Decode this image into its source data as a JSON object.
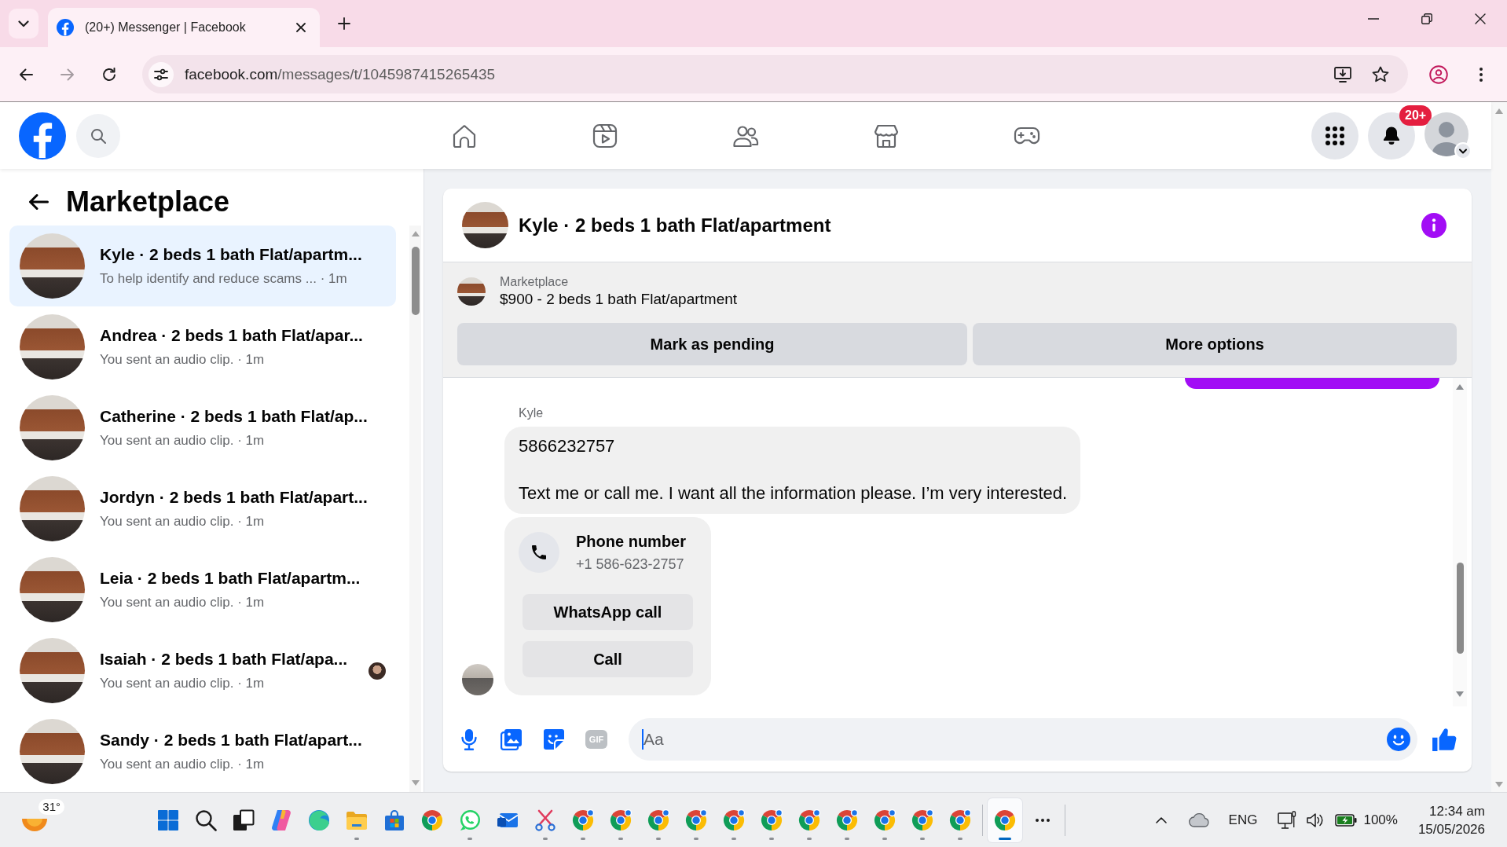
{
  "browser": {
    "tab_title": "(20+) Messenger | Facebook",
    "url_host": "facebook.com",
    "url_path": "/messages/t/1045987415265435",
    "forward_disabled": true
  },
  "header": {
    "nav": [
      {
        "kind": "home"
      },
      {
        "kind": "video"
      },
      {
        "kind": "friends"
      },
      {
        "kind": "marketplace"
      },
      {
        "kind": "gaming"
      }
    ],
    "notification_badge": "20+"
  },
  "sidebar": {
    "title": "Marketplace",
    "conversations": [
      {
        "title": "Kyle · 2 beds 1 bath Flat/apartm...",
        "snippet": "To help identify and reduce scams ... · 1m",
        "selected": true,
        "seen_by": false
      },
      {
        "title": "Andrea · 2 beds 1 bath Flat/apar...",
        "snippet": "You sent an audio clip. · 1m",
        "selected": false,
        "seen_by": false
      },
      {
        "title": "Catherine · 2 beds 1 bath Flat/ap...",
        "snippet": "You sent an audio clip. · 1m",
        "selected": false,
        "seen_by": false
      },
      {
        "title": "Jordyn · 2 beds 1 bath Flat/apart...",
        "snippet": "You sent an audio clip. · 1m",
        "selected": false,
        "seen_by": false
      },
      {
        "title": "Leia · 2 beds 1 bath Flat/apartm...",
        "snippet": "You sent an audio clip. · 1m",
        "selected": false,
        "seen_by": false
      },
      {
        "title": "Isaiah · 2 beds 1 bath Flat/apa...",
        "snippet": "You sent an audio clip. · 1m",
        "selected": false,
        "seen_by": true
      },
      {
        "title": "Sandy · 2 beds 1 bath Flat/apart...",
        "snippet": "You sent an audio clip. · 1m",
        "selected": false,
        "seen_by": false
      }
    ]
  },
  "chat": {
    "title": "Kyle · 2 beds 1 bath Flat/apartment",
    "listing": {
      "label": "Marketplace",
      "description": "$900 - 2 beds 1 bath Flat/apartment",
      "actions": [
        "Mark as pending",
        "More options"
      ]
    },
    "messages": [
      {
        "kind": "sent_cut"
      },
      {
        "kind": "received",
        "sender": "Kyle",
        "items": [
          {
            "kind": "text",
            "paragraphs": [
              "5866232757",
              "Text me or call me. I want all the information please. I’m very interested."
            ]
          },
          {
            "kind": "contact",
            "title": "Phone number",
            "phone": "+1 586-623-2757",
            "actions": [
              "WhatsApp call",
              "Call"
            ]
          }
        ]
      }
    ],
    "composer": {
      "placeholder": "Aa",
      "gif_label": "GIF"
    }
  },
  "taskbar": {
    "temperature": "31°",
    "apps": [
      {
        "kind": "start",
        "running": false,
        "selected": false
      },
      {
        "kind": "search",
        "running": false,
        "selected": false
      },
      {
        "kind": "task_view",
        "running": false,
        "selected": false
      },
      {
        "kind": "copilot",
        "running": false,
        "selected": false
      },
      {
        "kind": "edge",
        "running": false,
        "selected": false
      },
      {
        "kind": "files",
        "running": true,
        "selected": false
      },
      {
        "kind": "store",
        "running": false,
        "selected": false
      },
      {
        "kind": "browser",
        "running": false,
        "selected": false
      },
      {
        "kind": "chat",
        "running": true,
        "selected": false
      },
      {
        "kind": "mail",
        "running": false,
        "selected": false
      },
      {
        "kind": "snip",
        "running": true,
        "selected": false
      },
      {
        "kind": "browser_profile",
        "running": true,
        "selected": false
      },
      {
        "kind": "browser_profile",
        "running": true,
        "selected": false
      },
      {
        "kind": "browser_profile",
        "running": true,
        "selected": false
      },
      {
        "kind": "browser_profile",
        "running": true,
        "selected": false
      },
      {
        "kind": "browser_profile",
        "running": true,
        "selected": false
      },
      {
        "kind": "browser_profile",
        "running": true,
        "selected": false
      },
      {
        "kind": "browser_profile",
        "running": true,
        "selected": false
      },
      {
        "kind": "browser_profile",
        "running": true,
        "selected": false
      },
      {
        "kind": "browser_profile",
        "running": true,
        "selected": false
      },
      {
        "kind": "browser_profile",
        "running": true,
        "selected": false
      },
      {
        "kind": "browser_profile",
        "running": true,
        "selected": false
      }
    ],
    "overflow": [
      {
        "kind": "browser",
        "running": true,
        "selected": true
      }
    ],
    "language": "ENG",
    "battery": "100%",
    "time": "12:34 am",
    "date": "15/05/2026"
  }
}
